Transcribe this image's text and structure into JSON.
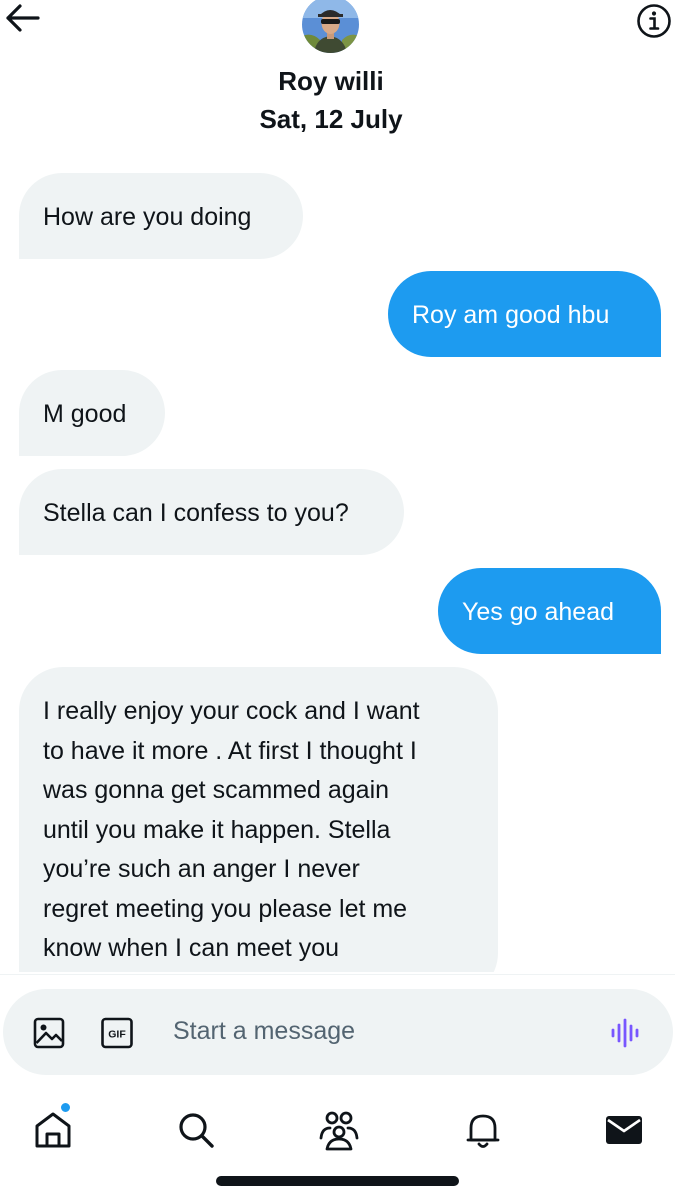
{
  "header": {
    "contact_name": "Roy willi",
    "date": "Sat, 12 July",
    "back_icon": "arrow-left-icon",
    "info_icon": "info-icon"
  },
  "messages": [
    {
      "direction": "incoming",
      "text": "How are you doing"
    },
    {
      "direction": "outgoing",
      "text": "Roy am good hbu"
    },
    {
      "direction": "incoming",
      "text": "M good"
    },
    {
      "direction": "incoming",
      "text": "Stella can I confess to you?"
    },
    {
      "direction": "outgoing",
      "text": "Yes go ahead"
    },
    {
      "direction": "incoming",
      "lines": [
        "I really enjoy your cock and I want",
        "to have it more . At first I thought I",
        "was gonna get scammed again",
        "until you make it happen. Stella",
        "you’re such an anger I never",
        "regret meeting you please let me",
        "know when I can meet you"
      ]
    }
  ],
  "composer": {
    "placeholder": "Start a message",
    "image_icon": "image-icon",
    "gif_label": "GIF",
    "voice_icon": "voice-waveform-icon"
  },
  "nav": [
    {
      "name": "home",
      "icon": "home-icon",
      "notification_dot": true
    },
    {
      "name": "search",
      "icon": "search-icon"
    },
    {
      "name": "communities",
      "icon": "communities-icon"
    },
    {
      "name": "notifications",
      "icon": "bell-icon"
    },
    {
      "name": "messages",
      "icon": "mail-icon",
      "active": true
    }
  ],
  "colors": {
    "outgoing_bubble": "#1d9bf0",
    "incoming_bubble": "#eff3f4",
    "text": "#0f1419",
    "placeholder": "#536471",
    "voice_accent": "#7856ff"
  }
}
